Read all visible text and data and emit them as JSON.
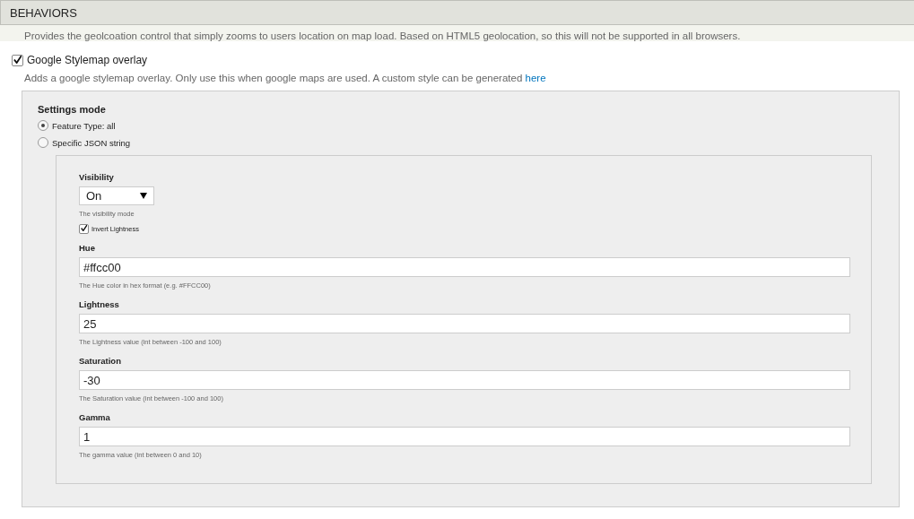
{
  "header": {
    "title": "BEHAVIORS"
  },
  "previous_description": "Provides the geolcoation control that simply zooms to users location on map load. Based on HTML5 geolocation, so this will not be supported in all browsers.",
  "behavior": {
    "label": "Google Stylemap overlay",
    "checked": true,
    "description": "Adds a google stylemap overlay. Only use this when google maps are used. A custom style can be generated ",
    "link": "here"
  },
  "settings_mode": {
    "title": "Settings mode",
    "options": [
      {
        "label": "Feature Type: all",
        "selected": true
      },
      {
        "label": "Specific JSON string",
        "selected": false
      }
    ]
  },
  "visibility": {
    "label": "Visibility",
    "value": "On",
    "hint": "The visibility mode"
  },
  "invert": {
    "label": "Invert Lightness",
    "checked": true
  },
  "fields": [
    {
      "label": "Hue",
      "value": "#ffcc00",
      "hint": "The Hue color in hex format (e.g. #FFCC00)"
    },
    {
      "label": "Lightness",
      "value": "25",
      "hint": "The Lightness value (int between -100 and 100)"
    },
    {
      "label": "Saturation",
      "value": "-30",
      "hint": "The Saturation value (int between -100 and 100)"
    },
    {
      "label": "Gamma",
      "value": "1",
      "hint": "The gamma value (int between 0 and 10)"
    }
  ]
}
